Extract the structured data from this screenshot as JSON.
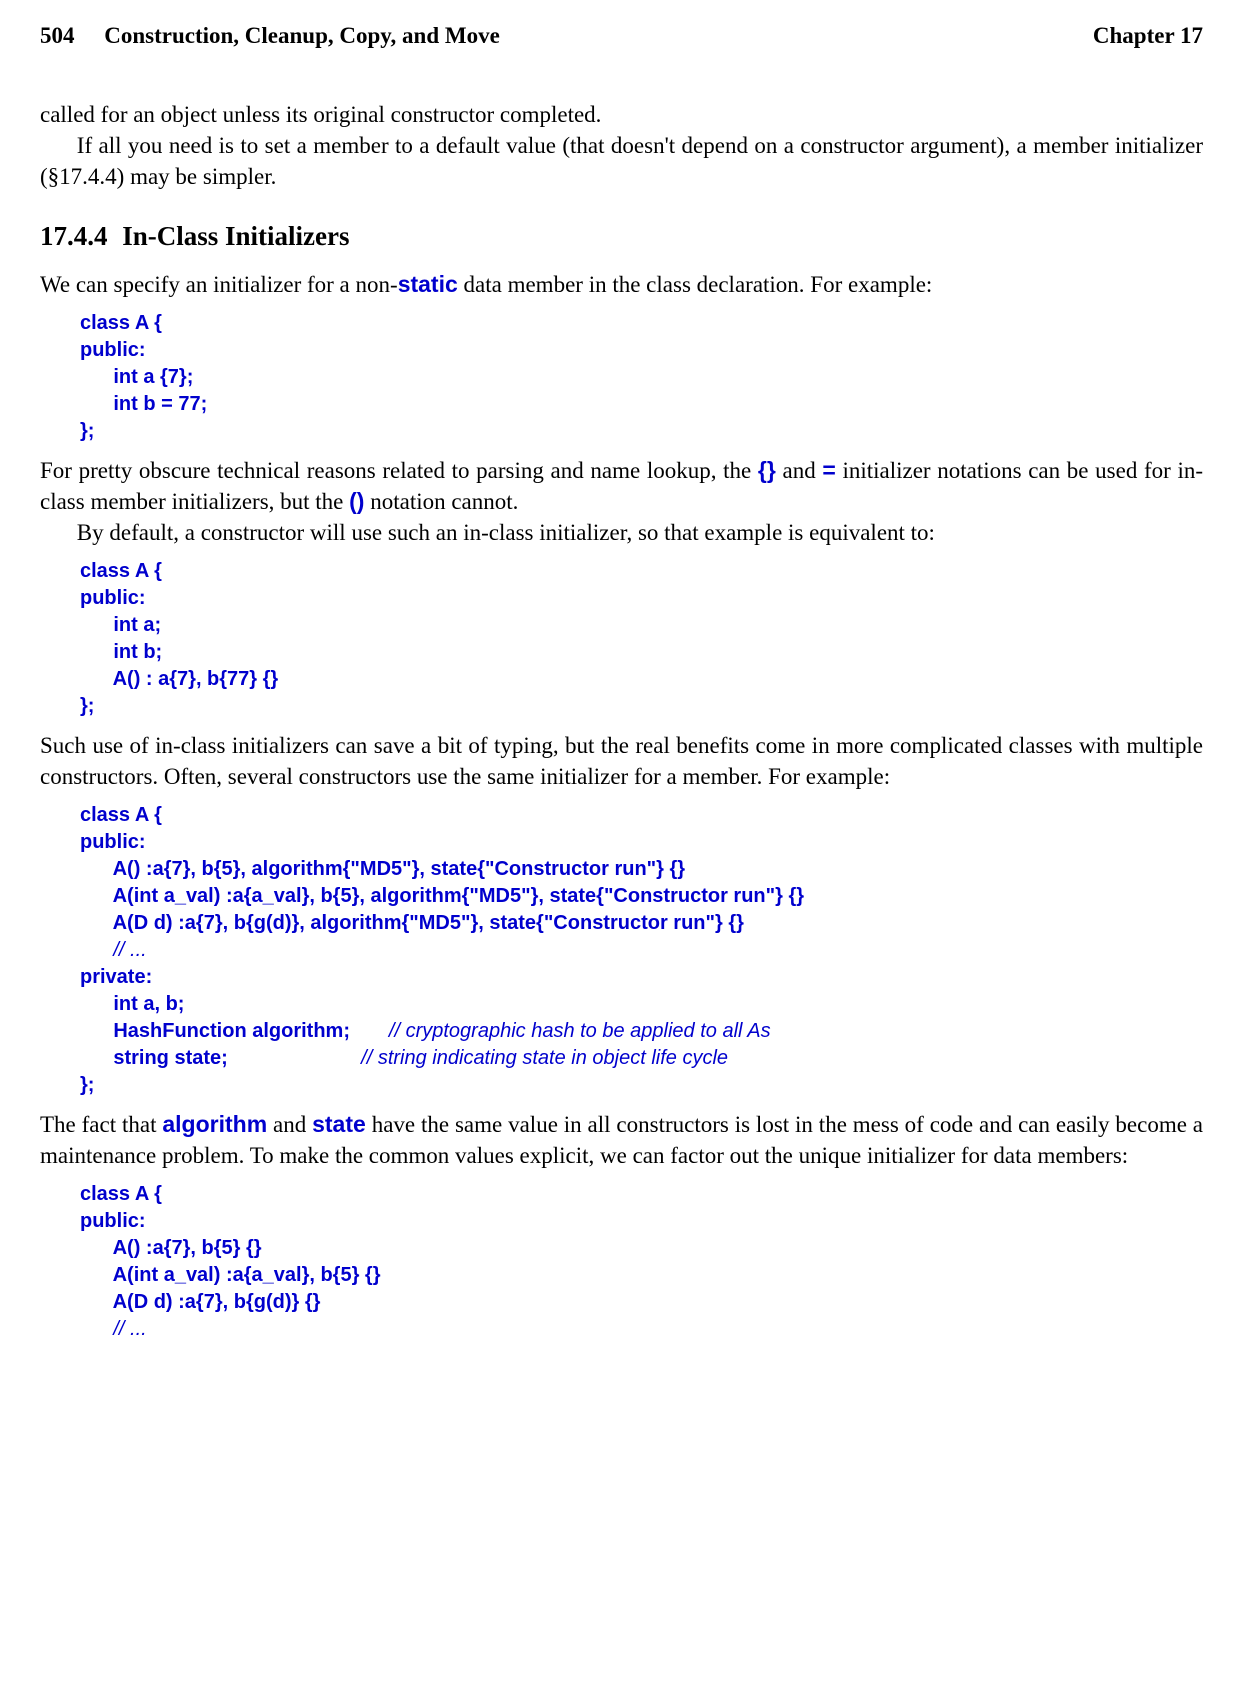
{
  "header": {
    "page_number": "504",
    "chapter_title": "Construction, Cleanup, Copy, and Move",
    "chapter_label": "Chapter 17"
  },
  "section": {
    "number": "17.4.4",
    "title": "In-Class Initializers"
  },
  "prose": {
    "p0": "called for an object unless its original constructor completed.",
    "p1": "If all you need is to set a member to a default value (that doesn't depend on a constructor argument), a member initializer (§17.4.4) may be simpler.",
    "p2a": "We can specify an initializer for a non-",
    "p2_static": "static",
    "p2b": " data member in the class declaration.  For example:",
    "p3a": "For pretty obscure technical reasons related to parsing and name lookup, the ",
    "p3_braces": "{}",
    "p3b": " and ",
    "p3_eq": "=",
    "p3c": " initializer notations can be used for in-class member initializers, but the ",
    "p3_paren": "()",
    "p3d": " notation cannot.",
    "p4": "By default, a constructor will use such an in-class initializer, so that example is equivalent to:",
    "p5": "Such use of in-class initializers can save a bit of typing, but the real benefits come in more complicated classes with multiple constructors.  Often, several constructors use the same initializer for a member.  For example:",
    "p6a": "The fact that ",
    "p6_alg": "algorithm",
    "p6b": " and ",
    "p6_state": "state",
    "p6c": " have the same value in all constructors is lost in the mess of code and can easily become a maintenance problem.  To make the common values explicit, we can factor out the unique initializer for data members:"
  },
  "code": {
    "block1": {
      "l0": "class A {",
      "l1": "public:",
      "l2": "      int a {7};",
      "l3": "      int b = 77;",
      "l4": "};"
    },
    "block2": {
      "l0": "class A {",
      "l1": "public:",
      "l2": "      int a;",
      "l3": "      int b;",
      "l4": "      A() : a{7}, b{77} {}",
      "l5": "};"
    },
    "block3": {
      "l0": "class A {",
      "l1": "public:",
      "l2": "      A() :a{7}, b{5}, algorithm{\"MD5\"}, state{\"Constructor run\"} {}",
      "l3": "      A(int a_val) :a{a_val}, b{5}, algorithm{\"MD5\"}, state{\"Constructor run\"} {}",
      "l4": "      A(D d) :a{7}, b{g(d)}, algorithm{\"MD5\"}, state{\"Constructor run\"} {}",
      "l5a": "      ",
      "l5b": "// ...",
      "l6": "private:",
      "l7": "      int a, b;",
      "l8a": "      HashFunction algorithm;",
      "l8pad": "       ",
      "l8b": "// cryptographic hash to be applied to all As",
      "l9a": "      string state;",
      "l9pad": "                        ",
      "l9b": "// string indicating state in object life cycle",
      "l10": "};"
    },
    "block4": {
      "l0": "class A {",
      "l1": "public:",
      "l2": "      A() :a{7}, b{5} {}",
      "l3": "      A(int a_val) :a{a_val}, b{5} {}",
      "l4": "      A(D d) :a{7}, b{g(d)} {}",
      "l5a": "      ",
      "l5b": "// ..."
    }
  }
}
